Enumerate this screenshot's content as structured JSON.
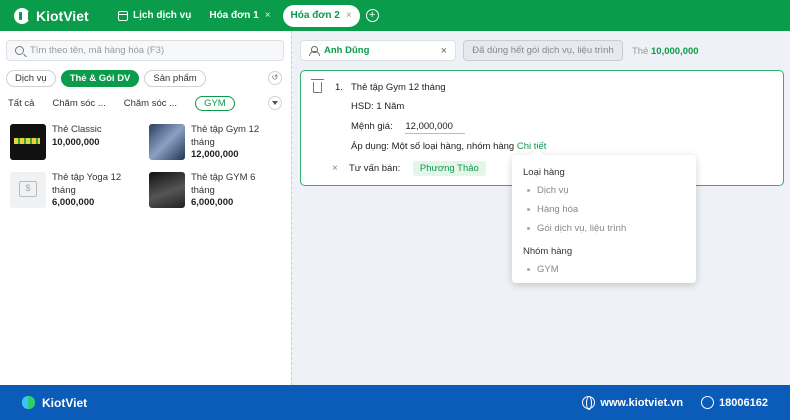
{
  "app": {
    "name": "KiotViet"
  },
  "topbar": {
    "service_tab": "Lịch dịch vụ",
    "tabs": [
      {
        "label": "Hóa đơn 1",
        "active": false
      },
      {
        "label": "Hóa đơn 2",
        "active": true
      }
    ],
    "close_glyph": "×",
    "add_glyph": "+"
  },
  "left": {
    "search": {
      "placeholder": "Tìm theo tên, mã hàng hóa (F3)",
      "value": ""
    },
    "chips": [
      "Dịch vụ",
      "Thẻ & Gói DV",
      "Sản phẩm"
    ],
    "active_chip": "Thẻ & Gói DV",
    "history_glyph": "↺",
    "subtabs": [
      "Tất cả",
      "Chăm sóc ...",
      "Chăm sóc ...",
      "GYM"
    ],
    "active_subtab": "GYM",
    "products": [
      {
        "name": "Thẻ Classic",
        "price": "10,000,000",
        "thumb": "classic-card-image"
      },
      {
        "name": "Thẻ tập Gym 12 tháng",
        "price": "12,000,000",
        "thumb": "gym-image"
      },
      {
        "name": "Thẻ tập Yoga 12 tháng",
        "price": "6,000,000",
        "thumb": "placeholder-icon"
      },
      {
        "name": "Thẻ tập GYM 6 tháng",
        "price": "6,000,000",
        "thumb": "gym-image"
      }
    ]
  },
  "right": {
    "customer": {
      "name": "Anh Dũng",
      "clear_glyph": "×"
    },
    "used_button": "Đã dùng hết gói dịch vụ, liệu trình",
    "card_label": "Thẻ",
    "card_balance": "10,000,000",
    "item": {
      "index": "1.",
      "name": "Thẻ tập Gym 12 tháng",
      "expiry": "HSD: 1 Năm",
      "face_value_label": "Mệnh giá:",
      "face_value": "12,000,000",
      "apply_label": "Áp dụng: Một số loại hàng, nhóm hàng",
      "apply_link": "Chi tiết",
      "remove_glyph": "×",
      "consultant_label": "Tư vấn bán:",
      "consultant": "Phương Thảo"
    },
    "popover": {
      "groups": [
        {
          "title": "Loại hàng",
          "items": [
            "Dịch vụ",
            "Hàng hóa",
            "Gói dịch vụ, liệu trình"
          ]
        },
        {
          "title": "Nhóm hàng",
          "items": [
            "GYM"
          ]
        }
      ]
    }
  },
  "footer": {
    "brand": "KiotViet",
    "website": "www.kiotviet.vn",
    "phone": "18006162"
  },
  "colors": {
    "brand_green": "#0a9b4b",
    "footer_blue": "#0b5bb8"
  }
}
